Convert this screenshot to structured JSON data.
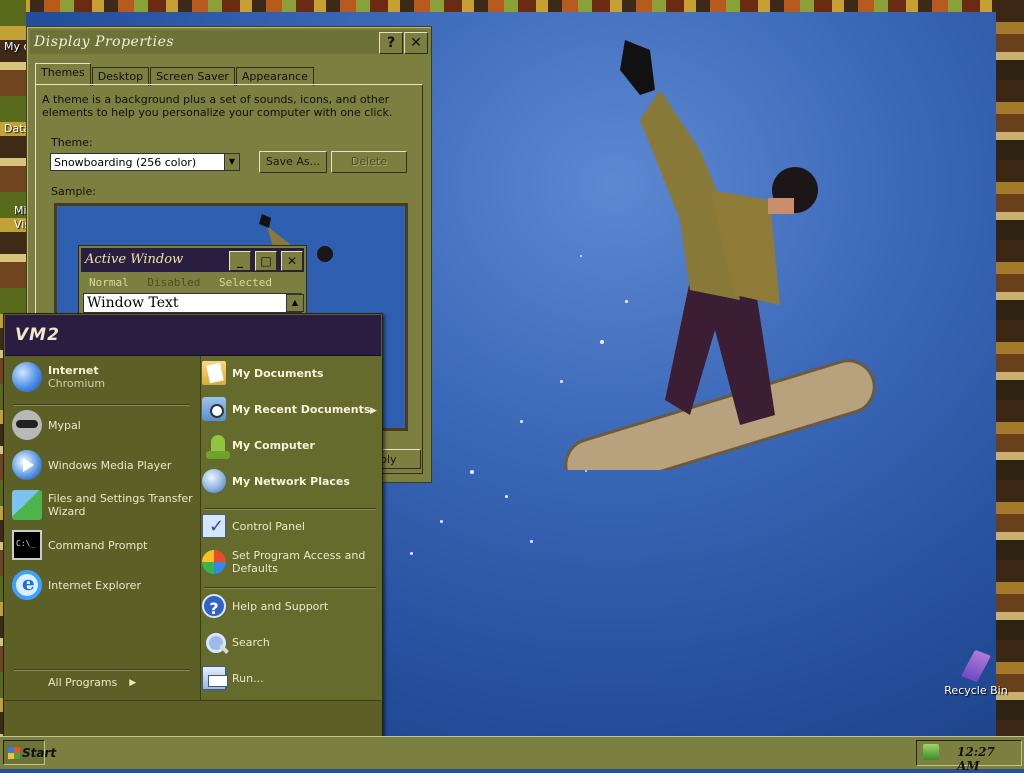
{
  "desktop": {
    "icons": [
      {
        "label": "My c"
      },
      {
        "label": "Data"
      },
      {
        "label": "Mi"
      },
      {
        "label": "Vis"
      }
    ],
    "recycle_bin": "Recycle Bin"
  },
  "display_properties": {
    "title": "Display Properties",
    "help_btn": "?",
    "close_btn": "✕",
    "tabs": [
      "Themes",
      "Desktop",
      "Screen Saver",
      "Appearance"
    ],
    "description": "A theme is a background plus a set of sounds, icons, and other elements to help you personalize your computer with one click.",
    "theme_label": "Theme:",
    "theme_value": "Snowboarding (256 color)",
    "save_as": "Save As...",
    "delete": "Delete",
    "sample_label": "Sample:",
    "apply": "ply",
    "sample": {
      "window_title": "Active Window",
      "menu": [
        "Normal",
        "Disabled",
        "Selected"
      ],
      "window_text": "Window Text"
    }
  },
  "start_menu": {
    "user": "VM2",
    "pinned": [
      {
        "title": "Internet",
        "subtitle": "Chromium",
        "icon": "chromium-globe-icon"
      },
      {
        "title": "Mypal",
        "icon": "raccoon-icon"
      },
      {
        "title": "Windows Media Player",
        "icon": "media-player-icon"
      },
      {
        "title": "Files and Settings Transfer",
        "title2": "Wizard",
        "icon": "transfer-wizard-icon"
      },
      {
        "title": "Command Prompt",
        "icon": "command-prompt-icon"
      },
      {
        "title": "Internet Explorer",
        "icon": "internet-explorer-icon"
      }
    ],
    "all_programs": "All Programs",
    "right": [
      {
        "title": "My Documents",
        "icon": "folder-documents-icon"
      },
      {
        "title": "My Recent Documents",
        "icon": "recent-documents-icon"
      },
      {
        "title": "My Computer",
        "icon": "computer-icon"
      },
      {
        "title": "My Network Places",
        "icon": "network-icon"
      },
      {
        "title": "Control Panel",
        "icon": "control-panel-icon"
      },
      {
        "title": "Set Program Access and",
        "title2": "Defaults",
        "icon": "program-access-icon"
      },
      {
        "title": "Help and Support",
        "icon": "help-icon"
      },
      {
        "title": "Search",
        "icon": "search-icon"
      },
      {
        "title": "Run...",
        "icon": "run-icon"
      }
    ]
  },
  "taskbar": {
    "start_label": "Start",
    "clock": "12:27 AM"
  }
}
